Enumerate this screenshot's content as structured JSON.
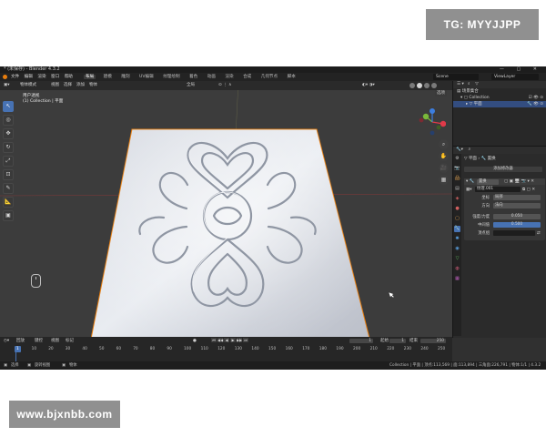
{
  "watermarks": {
    "top": "TG: MYYJJPP",
    "bottom": "www.bjxnbb.com"
  },
  "titlebar": {
    "title": "* (未保存) - Blender 4.3.2",
    "window_controls": "— ▢ ✕"
  },
  "menubar": {
    "menus": [
      "文件",
      "编辑",
      "渲染",
      "窗口",
      "帮助"
    ],
    "workspace_tabs": [
      "布局",
      "建模",
      "雕刻",
      "UV编辑",
      "纹理绘制",
      "着色",
      "动画",
      "渲染",
      "合成",
      "几何节点",
      "脚本"
    ],
    "active_workspace": "布局",
    "scene": "Scene",
    "view_layer": "ViewLayer"
  },
  "viewport": {
    "header": {
      "mode": "物体模式",
      "menus": [
        "视图",
        "选择",
        "添加",
        "物体"
      ],
      "orientation": "全局",
      "options": "选项"
    },
    "info": {
      "line1": "用户透视",
      "line2": "(1) Collection | 平面"
    },
    "tools": [
      "select",
      "cursor",
      "move",
      "rotate",
      "scale",
      "transform",
      "annotate",
      "measure",
      "add-cube"
    ],
    "nav_buttons": [
      "zoom",
      "pan",
      "camera",
      "perspective"
    ],
    "gizmo": {
      "x": "X",
      "y": "Y",
      "z": "Z",
      "x_color": "#e03a49",
      "y_color": "#7ab83a",
      "z_color": "#3c7ee0"
    },
    "accent_orange": "#e87d0d"
  },
  "timeline": {
    "header": {
      "playback": "回放",
      "keying": "键控",
      "view": "视图",
      "marker": "标记"
    },
    "current_frame": "1",
    "start_label": "起始",
    "start": "1",
    "end_label": "结束",
    "end": "250",
    "ruler": [
      "1",
      "10",
      "20",
      "30",
      "40",
      "50",
      "60",
      "70",
      "80",
      "90",
      "100",
      "110",
      "120",
      "130",
      "140",
      "150",
      "160",
      "170",
      "180",
      "190",
      "200",
      "210",
      "220",
      "230",
      "240",
      "250"
    ]
  },
  "statusbar": {
    "left": [
      "选择",
      "旋转视图",
      "物体"
    ],
    "right": "Collection | 平面 | 顶点:113,569 | 面:113,894 | 三角面:226,791 | 物体:1/1 | 4.3.2"
  },
  "outliner": {
    "title": "场景集合",
    "rows": [
      "场景集合",
      "Collection",
      "平面"
    ]
  },
  "properties": {
    "object_name": "平面",
    "modifier_name": "置换",
    "add_modifier": "添加修改器",
    "modifier_card": "置换",
    "texture": "纹理.001",
    "coords_label": "坐标",
    "coords_value": "局部",
    "direction_label": "方向",
    "direction_value": "法向",
    "strength_label": "强度/力度",
    "strength_value": "0.050",
    "midlevel_label": "中间值",
    "midlevel_value": "0.500",
    "vgroup_label": "顶点组"
  }
}
